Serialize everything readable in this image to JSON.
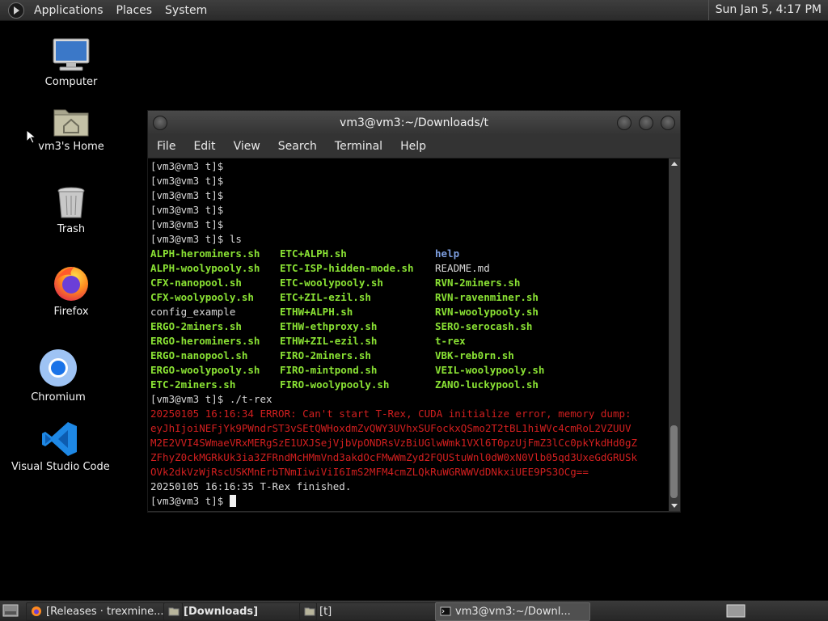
{
  "top_panel": {
    "menus": [
      "Applications",
      "Places",
      "System"
    ],
    "clock": "Sun Jan  5,  4:17 PM"
  },
  "desktop": {
    "icons": [
      {
        "label": "Computer",
        "icon": "monitor-icon"
      },
      {
        "label": "vm3's Home",
        "icon": "home-folder-icon"
      },
      {
        "label": "Trash",
        "icon": "trash-icon"
      },
      {
        "label": "Firefox",
        "icon": "firefox-icon"
      },
      {
        "label": "Chromium",
        "icon": "chromium-icon"
      },
      {
        "label": "Visual Studio Code",
        "icon": "vscode-icon"
      }
    ]
  },
  "terminal": {
    "title": "vm3@vm3:~/Downloads/t",
    "menus": [
      "File",
      "Edit",
      "View",
      "Search",
      "Terminal",
      "Help"
    ],
    "prompt_lines": [
      "[vm3@vm3 t]$",
      "[vm3@vm3 t]$",
      "[vm3@vm3 t]$",
      "[vm3@vm3 t]$",
      "[vm3@vm3 t]$",
      "[vm3@vm3 t]$ ls"
    ],
    "ls_columns": [
      [
        {
          "name": "ALPH-herominers.sh",
          "kind": "exe"
        },
        {
          "name": "ALPH-woolypooly.sh",
          "kind": "exe"
        },
        {
          "name": "CFX-nanopool.sh",
          "kind": "exe"
        },
        {
          "name": "CFX-woolypooly.sh",
          "kind": "exe"
        },
        {
          "name": "config_example",
          "kind": "plain"
        },
        {
          "name": "ERGO-2miners.sh",
          "kind": "exe"
        },
        {
          "name": "ERGO-herominers.sh",
          "kind": "exe"
        },
        {
          "name": "ERGO-nanopool.sh",
          "kind": "exe"
        },
        {
          "name": "ERGO-woolypooly.sh",
          "kind": "exe"
        },
        {
          "name": "ETC-2miners.sh",
          "kind": "exe"
        }
      ],
      [
        {
          "name": "ETC+ALPH.sh",
          "kind": "exe"
        },
        {
          "name": "ETC-ISP-hidden-mode.sh",
          "kind": "exe"
        },
        {
          "name": "ETC-woolypooly.sh",
          "kind": "exe"
        },
        {
          "name": "ETC+ZIL-ezil.sh",
          "kind": "exe"
        },
        {
          "name": "ETHW+ALPH.sh",
          "kind": "exe"
        },
        {
          "name": "ETHW-ethproxy.sh",
          "kind": "exe"
        },
        {
          "name": "ETHW+ZIL-ezil.sh",
          "kind": "exe"
        },
        {
          "name": "FIRO-2miners.sh",
          "kind": "exe"
        },
        {
          "name": "FIRO-mintpond.sh",
          "kind": "exe"
        },
        {
          "name": "FIRO-woolypooly.sh",
          "kind": "exe"
        }
      ],
      [
        {
          "name": "help",
          "kind": "dir"
        },
        {
          "name": "README.md",
          "kind": "plain"
        },
        {
          "name": "RVN-2miners.sh",
          "kind": "exe"
        },
        {
          "name": "RVN-ravenminer.sh",
          "kind": "exe"
        },
        {
          "name": "RVN-woolypooly.sh",
          "kind": "exe"
        },
        {
          "name": "SERO-serocash.sh",
          "kind": "exe"
        },
        {
          "name": "t-rex",
          "kind": "exe"
        },
        {
          "name": "VBK-reb0rn.sh",
          "kind": "exe"
        },
        {
          "name": "VEIL-woolypooly.sh",
          "kind": "exe"
        },
        {
          "name": "ZANO-luckypool.sh",
          "kind": "exe"
        }
      ]
    ],
    "run_command": "[vm3@vm3 t]$ ./t-rex",
    "error_lines": [
      "20250105 16:16:34 ERROR: Can't start T-Rex, CUDA initialize error, memory dump:",
      "eyJhIjoiNEFjYk9PWndrST3vSEtQWHoxdmZvQWY3UVhxSUFockxQSmo2T2tBL1hiWVc4cmRoL2VZUUV",
      "M2E2VVI4SWmaeVRxMERgSzE1UXJSejVjbVpONDRsVzBiUGlwWmk1VXl6T0pzUjFmZ3lCc0pkYkdHd0gZ",
      "ZFhyZ0ckMGRkUk3ia3ZFRndMcHMmVnd3akdOcFMwWmZyd2FQUStuWnl0dW0xN0Vlb05qd3UxeGdGRUSk",
      "OVk2dkVzWjRscUSKMnErbTNmIiwiViI6ImS2MFM4cmZLQkRuWGRWWVdDNkxiUEE9PS3OCg=="
    ],
    "finished_line": "20250105 16:16:35 T-Rex finished.",
    "final_prompt": "[vm3@vm3 t]$ "
  },
  "taskbar": {
    "tasks": [
      {
        "label": "[Releases · trexmine...",
        "icon": "firefox-icon"
      },
      {
        "label": "[Downloads]",
        "icon": "folder-icon"
      },
      {
        "label": "[t]",
        "icon": "folder-icon"
      },
      {
        "label": "vm3@vm3:~/Downl...",
        "icon": "terminal-icon"
      }
    ]
  }
}
